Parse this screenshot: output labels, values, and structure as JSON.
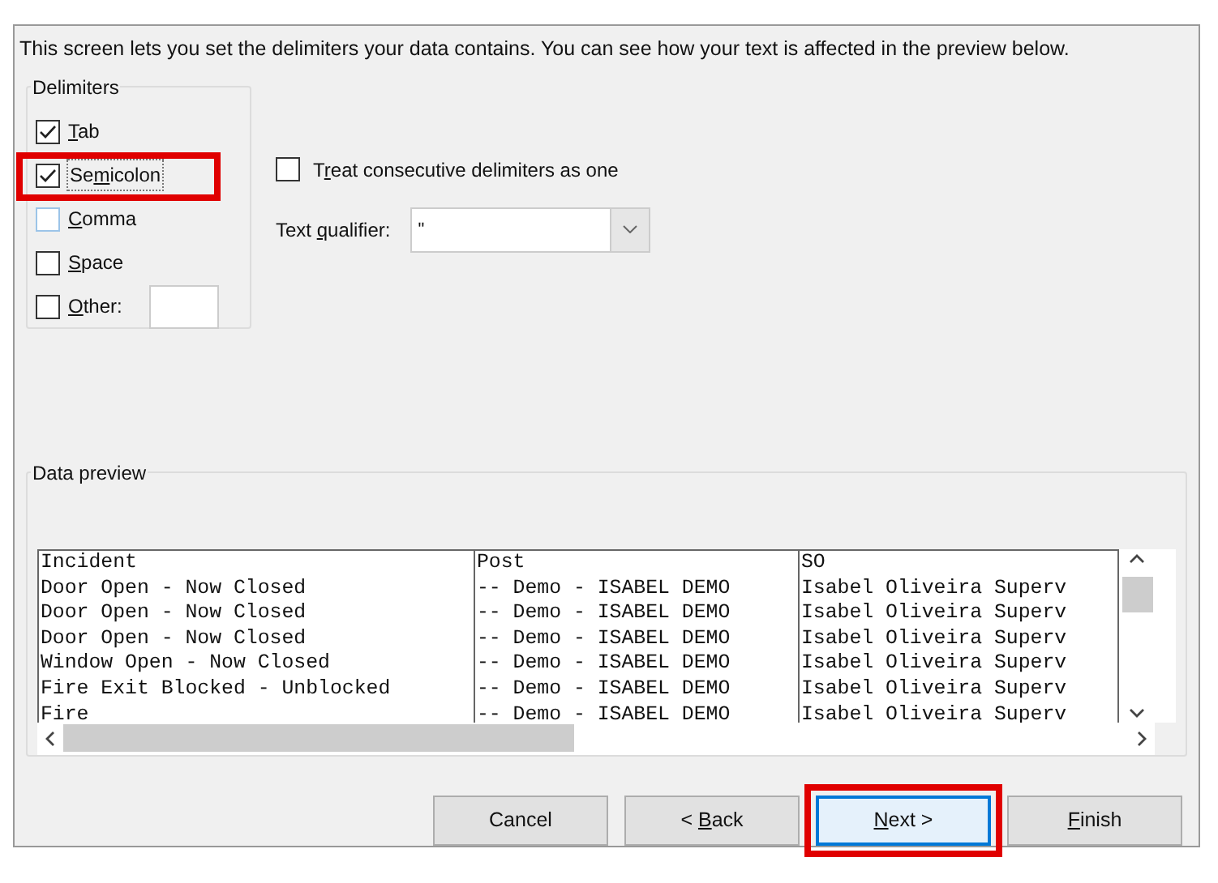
{
  "description": "This screen lets you set the delimiters your data contains.  You can see how your text is affected in the preview below.",
  "delimiters": {
    "title": "Delimiters",
    "items": [
      {
        "label": {
          "key": "T",
          "after": "ab"
        },
        "checked": true,
        "highlighted": false,
        "kind": "checkbox"
      },
      {
        "label": {
          "before": "Se",
          "key": "m",
          "after": "icolon"
        },
        "checked": true,
        "highlighted": true,
        "kind": "checkbox"
      },
      {
        "label": {
          "key": "C",
          "after": "omma"
        },
        "checked": false,
        "highlighted": false,
        "kind": "checkbox"
      },
      {
        "label": {
          "key": "S",
          "after": "pace"
        },
        "checked": false,
        "highlighted": false,
        "kind": "checkbox"
      },
      {
        "label": {
          "key": "O",
          "after": "ther:"
        },
        "checked": false,
        "highlighted": false,
        "kind": "with-field"
      }
    ]
  },
  "consecutive": {
    "label": {
      "before": "T",
      "key": "r",
      "after": "eat consecutive delimiters as one"
    },
    "checked": false
  },
  "text_qualifier": {
    "label": {
      "before": "Text ",
      "key": "q",
      "after": "ualifier:"
    },
    "value": "\""
  },
  "preview": {
    "title": "Data preview",
    "columns": [
      "Incident",
      "Post",
      "SO"
    ],
    "rows": [
      [
        "Door Open - Now Closed",
        "-- Demo - ISABEL DEMO",
        "Isabel Oliveira Superv"
      ],
      [
        "Door Open - Now Closed",
        "-- Demo - ISABEL DEMO",
        "Isabel Oliveira Superv"
      ],
      [
        "Door Open - Now Closed",
        "-- Demo - ISABEL DEMO",
        "Isabel Oliveira Superv"
      ],
      [
        "Window Open - Now Closed",
        "-- Demo - ISABEL DEMO",
        "Isabel Oliveira Superv"
      ],
      [
        "Fire Exit Blocked - Unblocked",
        "-- Demo - ISABEL DEMO",
        "Isabel Oliveira Superv"
      ],
      [
        "Fire",
        "-- Demo - ISABEL DEMO",
        "Isabel Oliveira Superv"
      ]
    ]
  },
  "buttons": [
    {
      "label": {
        "before": "Cancel"
      },
      "highlighted": false,
      "focused": false
    },
    {
      "label": {
        "before": "< ",
        "key": "B",
        "after": "ack"
      },
      "highlighted": false,
      "focused": false
    },
    {
      "label": {
        "key": "N",
        "after": "ext >"
      },
      "highlighted": true,
      "focused": true
    },
    {
      "label": {
        "key": "F",
        "after": "inish"
      },
      "highlighted": false,
      "focused": false
    }
  ]
}
